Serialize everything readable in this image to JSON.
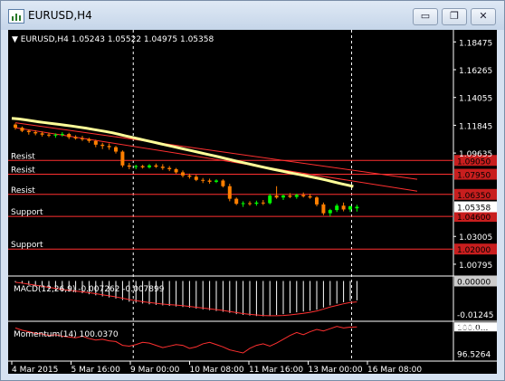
{
  "window": {
    "title": "EURUSD,H4",
    "buttons": {
      "minimize": "▭",
      "restore": "❐",
      "close": "✕"
    }
  },
  "chart_header": "▼ EURUSD,H4  1.05243 1.05522 1.04975 1.05358",
  "price_axis": {
    "ticks": [
      {
        "label": "1.18475",
        "value": 1.18475
      },
      {
        "label": "1.16265",
        "value": 1.16265
      },
      {
        "label": "1.14055",
        "value": 1.14055
      },
      {
        "label": "1.11845",
        "value": 1.11845
      },
      {
        "label": "1.09635",
        "value": 1.09635
      },
      {
        "label": "1.03005",
        "value": 1.03005
      },
      {
        "label": "1.00795",
        "value": 1.00795
      }
    ],
    "current_price": "1.05358"
  },
  "levels": [
    {
      "label": "Resist",
      "value": 1.0905,
      "price_tag": "1.09050",
      "label_offset": -2
    },
    {
      "label": "Resist",
      "value": 1.0795,
      "price_tag": "1.07950",
      "label_offset": -2
    },
    {
      "label": "Resist",
      "value": 1.0635,
      "price_tag": "1.06350",
      "label_offset": -2
    },
    {
      "label": "Support",
      "value": 1.046,
      "price_tag": "1.04600",
      "label_offset": -2
    },
    {
      "label": "Support",
      "value": 1.02,
      "price_tag": "1.02000",
      "label_offset": -2
    }
  ],
  "macd": {
    "label": "MACD(12,26,9) -0.007262 -0.007899",
    "axis": [
      {
        "label": "0.00000",
        "value": 0.0
      },
      {
        "label": "-0.01245",
        "value": -0.01245
      }
    ],
    "value_range": [
      -0.0145,
      0.0005
    ]
  },
  "momentum": {
    "label": "Momentum(14) 100.0370",
    "axis": [
      {
        "label": "100.0...",
        "value": 100.037
      },
      {
        "label": "100.1042",
        "value": 100.1042
      },
      {
        "label": "96.5264",
        "value": 96.5264
      }
    ],
    "value_range": [
      96.0,
      100.3
    ]
  },
  "time_axis": [
    "4 Mar 2015",
    "5 Mar 16:00",
    "9 Mar 00:00",
    "10 Mar 08:00",
    "11 Mar 16:00",
    "13 Mar 00:00",
    "16 Mar 08:00"
  ],
  "colors": {
    "background": "#000000",
    "axis": "#ffffff",
    "bull_candle": "#00ff00",
    "bear_candle": "#ff7f00",
    "level_line": "#ff3030",
    "price_tag_bg": "#c81e1e",
    "moving_average": "#ffff99",
    "current_tag_bg": "#ffffff"
  },
  "chart_data": {
    "type": "candlestick",
    "symbol": "EURUSD",
    "timeframe": "H4",
    "ylim": [
      1.0,
      1.19
    ],
    "candles": [
      {
        "o": 1.119,
        "h": 1.12,
        "l": 1.115,
        "c": 1.1165
      },
      {
        "o": 1.1165,
        "h": 1.1175,
        "l": 1.113,
        "c": 1.114
      },
      {
        "o": 1.114,
        "h": 1.115,
        "l": 1.111,
        "c": 1.113
      },
      {
        "o": 1.113,
        "h": 1.1145,
        "l": 1.1105,
        "c": 1.112
      },
      {
        "o": 1.112,
        "h": 1.1135,
        "l": 1.1095,
        "c": 1.111
      },
      {
        "o": 1.111,
        "h": 1.1125,
        "l": 1.109,
        "c": 1.1105
      },
      {
        "o": 1.1105,
        "h": 1.112,
        "l": 1.1085,
        "c": 1.111
      },
      {
        "o": 1.111,
        "h": 1.113,
        "l": 1.1095,
        "c": 1.1115
      },
      {
        "o": 1.1115,
        "h": 1.1125,
        "l": 1.1075,
        "c": 1.109
      },
      {
        "o": 1.109,
        "h": 1.1105,
        "l": 1.107,
        "c": 1.108
      },
      {
        "o": 1.108,
        "h": 1.11,
        "l": 1.106,
        "c": 1.1075
      },
      {
        "o": 1.1075,
        "h": 1.1085,
        "l": 1.1045,
        "c": 1.106
      },
      {
        "o": 1.106,
        "h": 1.107,
        "l": 1.101,
        "c": 1.103
      },
      {
        "o": 1.103,
        "h": 1.1045,
        "l": 1.0995,
        "c": 1.102
      },
      {
        "o": 1.102,
        "h": 1.104,
        "l": 1.099,
        "c": 1.101
      },
      {
        "o": 1.101,
        "h": 1.102,
        "l": 1.096,
        "c": 1.0975
      },
      {
        "o": 1.0975,
        "h": 1.0985,
        "l": 1.085,
        "c": 1.0865
      },
      {
        "o": 1.0865,
        "h": 1.0885,
        "l": 1.0835,
        "c": 1.0855
      },
      {
        "o": 1.0855,
        "h": 1.087,
        "l": 1.0835,
        "c": 1.086
      },
      {
        "o": 1.086,
        "h": 1.087,
        "l": 1.084,
        "c": 1.085
      },
      {
        "o": 1.085,
        "h": 1.0875,
        "l": 1.084,
        "c": 1.0865
      },
      {
        "o": 1.0865,
        "h": 1.088,
        "l": 1.0845,
        "c": 1.0855
      },
      {
        "o": 1.0855,
        "h": 1.0875,
        "l": 1.083,
        "c": 1.0845
      },
      {
        "o": 1.0845,
        "h": 1.086,
        "l": 1.082,
        "c": 1.0835
      },
      {
        "o": 1.0835,
        "h": 1.0845,
        "l": 1.08,
        "c": 1.081
      },
      {
        "o": 1.081,
        "h": 1.0825,
        "l": 1.077,
        "c": 1.0785
      },
      {
        "o": 1.0785,
        "h": 1.08,
        "l": 1.076,
        "c": 1.0775
      },
      {
        "o": 1.0775,
        "h": 1.079,
        "l": 1.074,
        "c": 1.075
      },
      {
        "o": 1.075,
        "h": 1.0765,
        "l": 1.0725,
        "c": 1.0745
      },
      {
        "o": 1.0745,
        "h": 1.076,
        "l": 1.072,
        "c": 1.0735
      },
      {
        "o": 1.0735,
        "h": 1.0755,
        "l": 1.0725,
        "c": 1.0745
      },
      {
        "o": 1.0745,
        "h": 1.0755,
        "l": 1.069,
        "c": 1.07
      },
      {
        "o": 1.07,
        "h": 1.072,
        "l": 1.058,
        "c": 1.06
      },
      {
        "o": 1.06,
        "h": 1.061,
        "l": 1.055,
        "c": 1.056
      },
      {
        "o": 1.056,
        "h": 1.058,
        "l": 1.0535,
        "c": 1.0565
      },
      {
        "o": 1.0565,
        "h": 1.058,
        "l": 1.0545,
        "c": 1.056
      },
      {
        "o": 1.056,
        "h": 1.0585,
        "l": 1.0545,
        "c": 1.057
      },
      {
        "o": 1.057,
        "h": 1.059,
        "l": 1.055,
        "c": 1.0565
      },
      {
        "o": 1.0565,
        "h": 1.064,
        "l": 1.0555,
        "c": 1.0625
      },
      {
        "o": 1.0625,
        "h": 1.07,
        "l": 1.06,
        "c": 1.061
      },
      {
        "o": 1.061,
        "h": 1.0635,
        "l": 1.059,
        "c": 1.0625
      },
      {
        "o": 1.0625,
        "h": 1.0645,
        "l": 1.0605,
        "c": 1.0615
      },
      {
        "o": 1.0615,
        "h": 1.064,
        "l": 1.06,
        "c": 1.063
      },
      {
        "o": 1.063,
        "h": 1.065,
        "l": 1.061,
        "c": 1.062
      },
      {
        "o": 1.062,
        "h": 1.064,
        "l": 1.06,
        "c": 1.061
      },
      {
        "o": 1.061,
        "h": 1.062,
        "l": 1.054,
        "c": 1.0555
      },
      {
        "o": 1.0555,
        "h": 1.057,
        "l": 1.047,
        "c": 1.0485
      },
      {
        "o": 1.0485,
        "h": 1.052,
        "l": 1.046,
        "c": 1.051
      },
      {
        "o": 1.051,
        "h": 1.056,
        "l": 1.0495,
        "c": 1.0545
      },
      {
        "o": 1.0545,
        "h": 1.057,
        "l": 1.05,
        "c": 1.0515
      },
      {
        "o": 1.0515,
        "h": 1.0545,
        "l": 1.0495,
        "c": 1.054
      },
      {
        "o": 1.0524,
        "h": 1.0552,
        "l": 1.0498,
        "c": 1.0536
      }
    ],
    "moving_average": [
      1.124,
      1.1235,
      1.1228,
      1.122,
      1.1212,
      1.1205,
      1.1198,
      1.1192,
      1.1185,
      1.1178,
      1.117,
      1.1162,
      1.1153,
      1.1144,
      1.1135,
      1.1125,
      1.1113,
      1.11,
      1.1088,
      1.1076,
      1.1064,
      1.1052,
      1.104,
      1.1028,
      1.1016,
      1.1004,
      1.0992,
      1.098,
      1.0968,
      1.0956,
      1.0944,
      1.0932,
      1.0919,
      1.0906,
      1.0894,
      1.0882,
      1.087,
      1.0858,
      1.0846,
      1.0835,
      1.0824,
      1.0813,
      1.0802,
      1.0792,
      1.0782,
      1.0771,
      1.076,
      1.0748,
      1.0735,
      1.0722,
      1.071,
      1.0698
    ],
    "trendlines": [
      {
        "from": [
          0,
          1.1165
        ],
        "to": [
          60,
          1.066
        ]
      },
      {
        "from": [
          0,
          1.1205
        ],
        "to": [
          60,
          1.0755
        ]
      }
    ],
    "macd_histogram": [
      -0.0005,
      -0.001,
      -0.0015,
      -0.002,
      -0.0025,
      -0.003,
      -0.0035,
      -0.0038,
      -0.004,
      -0.0043,
      -0.0046,
      -0.005,
      -0.0054,
      -0.0058,
      -0.0062,
      -0.0066,
      -0.0072,
      -0.0078,
      -0.0082,
      -0.0085,
      -0.0088,
      -0.009,
      -0.0092,
      -0.0094,
      -0.0096,
      -0.0098,
      -0.0101,
      -0.0104,
      -0.0107,
      -0.011,
      -0.0113,
      -0.0116,
      -0.012,
      -0.0125,
      -0.0128,
      -0.013,
      -0.0132,
      -0.0133,
      -0.0132,
      -0.0128,
      -0.0125,
      -0.0121,
      -0.0118,
      -0.0115,
      -0.0112,
      -0.0108,
      -0.01,
      -0.0092,
      -0.0085,
      -0.008,
      -0.0075,
      -0.0073
    ],
    "macd_signal": [
      -0.0005,
      -0.0008,
      -0.0012,
      -0.0016,
      -0.002,
      -0.0024,
      -0.0028,
      -0.0032,
      -0.0035,
      -0.0038,
      -0.0041,
      -0.0044,
      -0.0048,
      -0.0052,
      -0.0056,
      -0.006,
      -0.0065,
      -0.007,
      -0.0074,
      -0.0078,
      -0.0081,
      -0.0084,
      -0.0087,
      -0.0089,
      -0.0091,
      -0.0093,
      -0.0096,
      -0.0099,
      -0.0102,
      -0.0105,
      -0.0108,
      -0.0111,
      -0.0115,
      -0.0119,
      -0.0123,
      -0.0126,
      -0.0128,
      -0.013,
      -0.0131,
      -0.0131,
      -0.013,
      -0.0128,
      -0.0125,
      -0.0122,
      -0.0118,
      -0.0113,
      -0.0106,
      -0.0098,
      -0.0092,
      -0.0086,
      -0.0081,
      -0.0079
    ],
    "momentum": [
      99.9,
      99.6,
      99.4,
      99.2,
      99.1,
      98.9,
      99.0,
      98.8,
      98.7,
      98.6,
      98.8,
      98.5,
      98.3,
      98.4,
      98.2,
      98.1,
      97.6,
      97.5,
      97.7,
      98.0,
      97.9,
      97.6,
      97.3,
      97.5,
      97.7,
      97.6,
      97.2,
      97.4,
      97.8,
      98.0,
      97.7,
      97.4,
      97.0,
      96.8,
      96.6,
      97.2,
      97.6,
      97.8,
      97.5,
      97.9,
      98.4,
      98.9,
      99.3,
      99.0,
      99.4,
      99.7,
      99.5,
      99.8,
      100.1,
      99.9,
      100.0,
      100.037
    ]
  }
}
